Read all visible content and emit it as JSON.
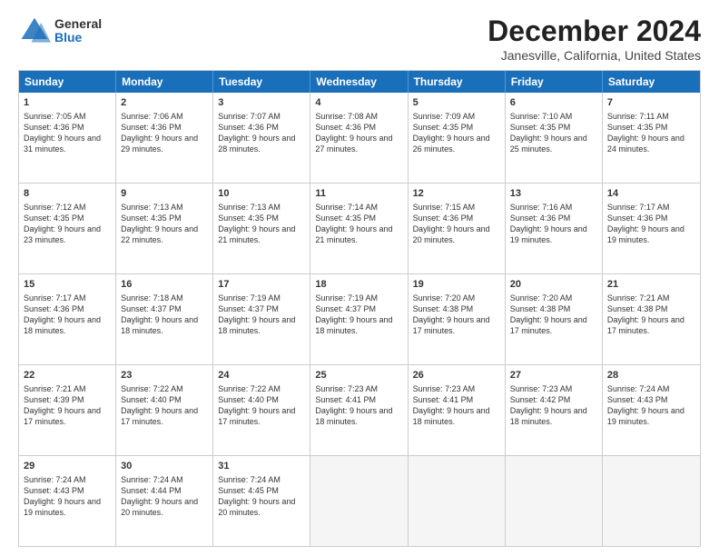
{
  "header": {
    "logo": {
      "line1": "General",
      "line2": "Blue"
    },
    "title": "December 2024",
    "subtitle": "Janesville, California, United States"
  },
  "days_of_week": [
    "Sunday",
    "Monday",
    "Tuesday",
    "Wednesday",
    "Thursday",
    "Friday",
    "Saturday"
  ],
  "weeks": [
    [
      {
        "day": "1",
        "sunrise": "Sunrise: 7:05 AM",
        "sunset": "Sunset: 4:36 PM",
        "daylight": "Daylight: 9 hours and 31 minutes."
      },
      {
        "day": "2",
        "sunrise": "Sunrise: 7:06 AM",
        "sunset": "Sunset: 4:36 PM",
        "daylight": "Daylight: 9 hours and 29 minutes."
      },
      {
        "day": "3",
        "sunrise": "Sunrise: 7:07 AM",
        "sunset": "Sunset: 4:36 PM",
        "daylight": "Daylight: 9 hours and 28 minutes."
      },
      {
        "day": "4",
        "sunrise": "Sunrise: 7:08 AM",
        "sunset": "Sunset: 4:36 PM",
        "daylight": "Daylight: 9 hours and 27 minutes."
      },
      {
        "day": "5",
        "sunrise": "Sunrise: 7:09 AM",
        "sunset": "Sunset: 4:35 PM",
        "daylight": "Daylight: 9 hours and 26 minutes."
      },
      {
        "day": "6",
        "sunrise": "Sunrise: 7:10 AM",
        "sunset": "Sunset: 4:35 PM",
        "daylight": "Daylight: 9 hours and 25 minutes."
      },
      {
        "day": "7",
        "sunrise": "Sunrise: 7:11 AM",
        "sunset": "Sunset: 4:35 PM",
        "daylight": "Daylight: 9 hours and 24 minutes."
      }
    ],
    [
      {
        "day": "8",
        "sunrise": "Sunrise: 7:12 AM",
        "sunset": "Sunset: 4:35 PM",
        "daylight": "Daylight: 9 hours and 23 minutes."
      },
      {
        "day": "9",
        "sunrise": "Sunrise: 7:13 AM",
        "sunset": "Sunset: 4:35 PM",
        "daylight": "Daylight: 9 hours and 22 minutes."
      },
      {
        "day": "10",
        "sunrise": "Sunrise: 7:13 AM",
        "sunset": "Sunset: 4:35 PM",
        "daylight": "Daylight: 9 hours and 21 minutes."
      },
      {
        "day": "11",
        "sunrise": "Sunrise: 7:14 AM",
        "sunset": "Sunset: 4:35 PM",
        "daylight": "Daylight: 9 hours and 21 minutes."
      },
      {
        "day": "12",
        "sunrise": "Sunrise: 7:15 AM",
        "sunset": "Sunset: 4:36 PM",
        "daylight": "Daylight: 9 hours and 20 minutes."
      },
      {
        "day": "13",
        "sunrise": "Sunrise: 7:16 AM",
        "sunset": "Sunset: 4:36 PM",
        "daylight": "Daylight: 9 hours and 19 minutes."
      },
      {
        "day": "14",
        "sunrise": "Sunrise: 7:17 AM",
        "sunset": "Sunset: 4:36 PM",
        "daylight": "Daylight: 9 hours and 19 minutes."
      }
    ],
    [
      {
        "day": "15",
        "sunrise": "Sunrise: 7:17 AM",
        "sunset": "Sunset: 4:36 PM",
        "daylight": "Daylight: 9 hours and 18 minutes."
      },
      {
        "day": "16",
        "sunrise": "Sunrise: 7:18 AM",
        "sunset": "Sunset: 4:37 PM",
        "daylight": "Daylight: 9 hours and 18 minutes."
      },
      {
        "day": "17",
        "sunrise": "Sunrise: 7:19 AM",
        "sunset": "Sunset: 4:37 PM",
        "daylight": "Daylight: 9 hours and 18 minutes."
      },
      {
        "day": "18",
        "sunrise": "Sunrise: 7:19 AM",
        "sunset": "Sunset: 4:37 PM",
        "daylight": "Daylight: 9 hours and 18 minutes."
      },
      {
        "day": "19",
        "sunrise": "Sunrise: 7:20 AM",
        "sunset": "Sunset: 4:38 PM",
        "daylight": "Daylight: 9 hours and 17 minutes."
      },
      {
        "day": "20",
        "sunrise": "Sunrise: 7:20 AM",
        "sunset": "Sunset: 4:38 PM",
        "daylight": "Daylight: 9 hours and 17 minutes."
      },
      {
        "day": "21",
        "sunrise": "Sunrise: 7:21 AM",
        "sunset": "Sunset: 4:38 PM",
        "daylight": "Daylight: 9 hours and 17 minutes."
      }
    ],
    [
      {
        "day": "22",
        "sunrise": "Sunrise: 7:21 AM",
        "sunset": "Sunset: 4:39 PM",
        "daylight": "Daylight: 9 hours and 17 minutes."
      },
      {
        "day": "23",
        "sunrise": "Sunrise: 7:22 AM",
        "sunset": "Sunset: 4:40 PM",
        "daylight": "Daylight: 9 hours and 17 minutes."
      },
      {
        "day": "24",
        "sunrise": "Sunrise: 7:22 AM",
        "sunset": "Sunset: 4:40 PM",
        "daylight": "Daylight: 9 hours and 17 minutes."
      },
      {
        "day": "25",
        "sunrise": "Sunrise: 7:23 AM",
        "sunset": "Sunset: 4:41 PM",
        "daylight": "Daylight: 9 hours and 18 minutes."
      },
      {
        "day": "26",
        "sunrise": "Sunrise: 7:23 AM",
        "sunset": "Sunset: 4:41 PM",
        "daylight": "Daylight: 9 hours and 18 minutes."
      },
      {
        "day": "27",
        "sunrise": "Sunrise: 7:23 AM",
        "sunset": "Sunset: 4:42 PM",
        "daylight": "Daylight: 9 hours and 18 minutes."
      },
      {
        "day": "28",
        "sunrise": "Sunrise: 7:24 AM",
        "sunset": "Sunset: 4:43 PM",
        "daylight": "Daylight: 9 hours and 19 minutes."
      }
    ],
    [
      {
        "day": "29",
        "sunrise": "Sunrise: 7:24 AM",
        "sunset": "Sunset: 4:43 PM",
        "daylight": "Daylight: 9 hours and 19 minutes."
      },
      {
        "day": "30",
        "sunrise": "Sunrise: 7:24 AM",
        "sunset": "Sunset: 4:44 PM",
        "daylight": "Daylight: 9 hours and 20 minutes."
      },
      {
        "day": "31",
        "sunrise": "Sunrise: 7:24 AM",
        "sunset": "Sunset: 4:45 PM",
        "daylight": "Daylight: 9 hours and 20 minutes."
      },
      null,
      null,
      null,
      null
    ]
  ]
}
